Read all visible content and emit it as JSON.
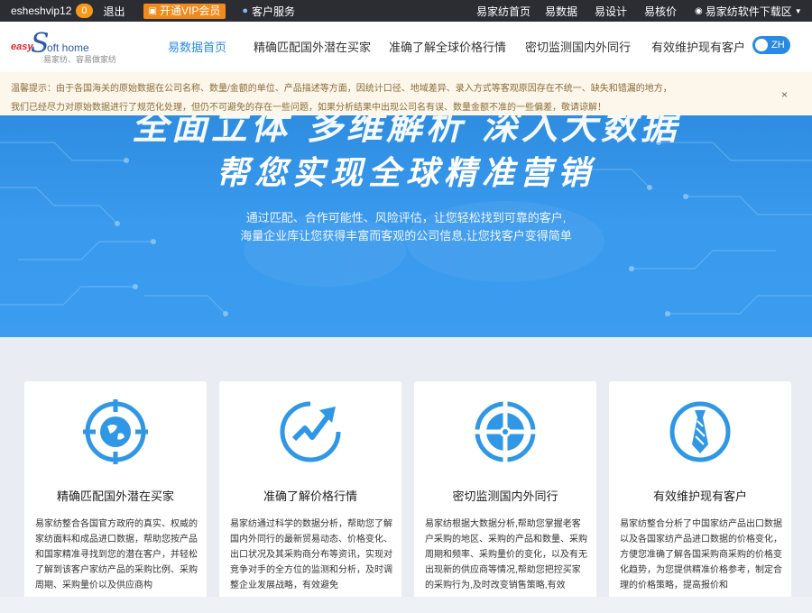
{
  "topbar": {
    "username": "esheshvip12",
    "badge_count": "0",
    "logout": "退出",
    "vip_label": "开通VIP会员",
    "service_label": "客户服务",
    "links": [
      "易家纺首页",
      "易数据",
      "易设计",
      "易核价"
    ],
    "download_label": "易家纺软件下载区"
  },
  "logo": {
    "easy": "easy",
    "s": "S",
    "oft": "oft home",
    "slogan": "易家纺、容易做家纺"
  },
  "nav": {
    "items": [
      "易数据首页",
      "精确匹配国外潜在买家",
      "准确了解全球价格行情",
      "密切监测国内外同行",
      "有效维护现有客户"
    ],
    "lang_toggle": "ZH"
  },
  "notice": {
    "line1": "温馨提示：由于各国海关的原始数据在公司名称、数量/金额的单位、产品描述等方面，因统计口径、地域差异、录入方式等客观原因存在不统一、缺失和错漏的地方，",
    "line2": "我们已经尽力对原始数据进行了规范化处理，但仍不可避免的存在一些问题，如果分析结果中出现公司名有误、数量金额不准的一些偏差，敬请谅解！",
    "close": "×"
  },
  "banner": {
    "headline_top": "全面立体 多维解析 深入大数据",
    "headline": "帮您实现全球精准营销",
    "sub1": "通过匹配、合作可能性、风险评估，让您轻松找到可靠的客户,",
    "sub2": "海量企业库让您获得丰富而客观的公司信息,让您找客户变得简单"
  },
  "cards": [
    {
      "icon": "globe-target-icon",
      "title": "精确匹配国外潜在买家",
      "desc": "易家纺整合各国官方政府的真实、权威的家纺面料和成品进口数据，帮助您按产品和国家精准寻找到您的潜在客户，并轻松了解到该客户家纺产品的采购比例、采购周期、采购量价以及供应商构"
    },
    {
      "icon": "trend-chart-icon",
      "title": "准确了解价格行情",
      "desc": "易家纺通过科学的数据分析，帮助您了解国内外同行的最新贸易动态、价格变化、出口状况及其采购商分布等资讯，实现对竞争对手的全方位的监测和分析，及时调整企业发展战略，有效避免"
    },
    {
      "icon": "crosshair-icon",
      "title": "密切监测国内外同行",
      "desc": "易家纺根据大数据分析,帮助您掌握老客户采购的地区、采购的产品和数量、采购周期和频率、采购量价的变化，以及有无出现新的供应商等情况,帮助您把控买家的采购行为,及时改变销售策略,有效"
    },
    {
      "icon": "tie-icon",
      "title": "有效维护现有客户",
      "desc": "易家纺整合分析了中国家纺产品出口数据以及各国家纺产品进口数据的价格变化，方便您准确了解各国采购商采购的价格变化趋势，为您提供精准价格参考，制定合理的价格策略，提高报价和"
    }
  ]
}
